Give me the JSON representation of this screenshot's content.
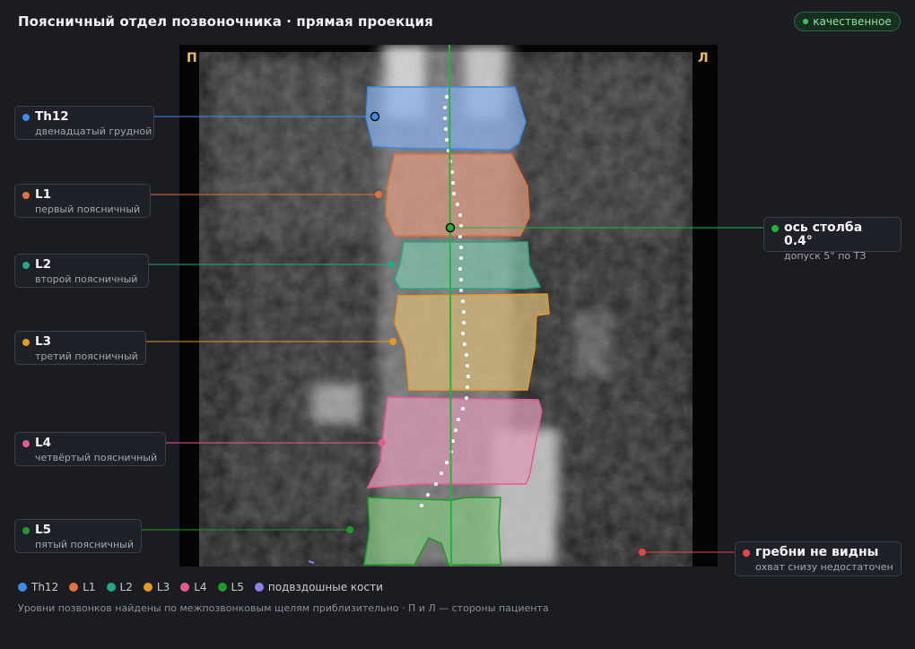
{
  "header": {
    "title": "Поясничный отдел позвоночника · прямая проекция",
    "badge": "качественное",
    "badge_color": "#42c35a"
  },
  "viewer": {
    "side_right_patient": "П",
    "side_left_patient": "Л",
    "axis_color": "#22b33a"
  },
  "vertebrae": [
    {
      "code": "Th12",
      "name": "двенадцатый грудной",
      "color": "#3d8ce8"
    },
    {
      "code": "L1",
      "name": "первый поясничный",
      "color": "#e8703a"
    },
    {
      "code": "L2",
      "name": "второй поясничный",
      "color": "#22a887"
    },
    {
      "code": "L3",
      "name": "третий поясничный",
      "color": "#e69a1e"
    },
    {
      "code": "L4",
      "name": "четвёртый поясничный",
      "color": "#e55a93"
    },
    {
      "code": "L5",
      "name": "пятый поясничный",
      "color": "#1f9a2c"
    }
  ],
  "findings": {
    "axis": {
      "label": "ось столба 0.4°",
      "note": "допуск 5° по ТЗ",
      "color": "#22b33a"
    },
    "crests": {
      "label": "гребни не видны",
      "note": "охват снизу недостаточен",
      "color": "#e04848"
    }
  },
  "legend": [
    {
      "label": "Th12",
      "color": "#3d8ce8"
    },
    {
      "label": "L1",
      "color": "#e8703a"
    },
    {
      "label": "L2",
      "color": "#22a887"
    },
    {
      "label": "L3",
      "color": "#e69a1e"
    },
    {
      "label": "L4",
      "color": "#e55a93"
    },
    {
      "label": "L5",
      "color": "#1f9a2c"
    },
    {
      "label": "подвздошные кости",
      "color": "#8b80e8"
    }
  ],
  "footer": "Уровни позвонков найдены по межпозвонковым щелям приблизительно · П и Л — стороны пациента"
}
